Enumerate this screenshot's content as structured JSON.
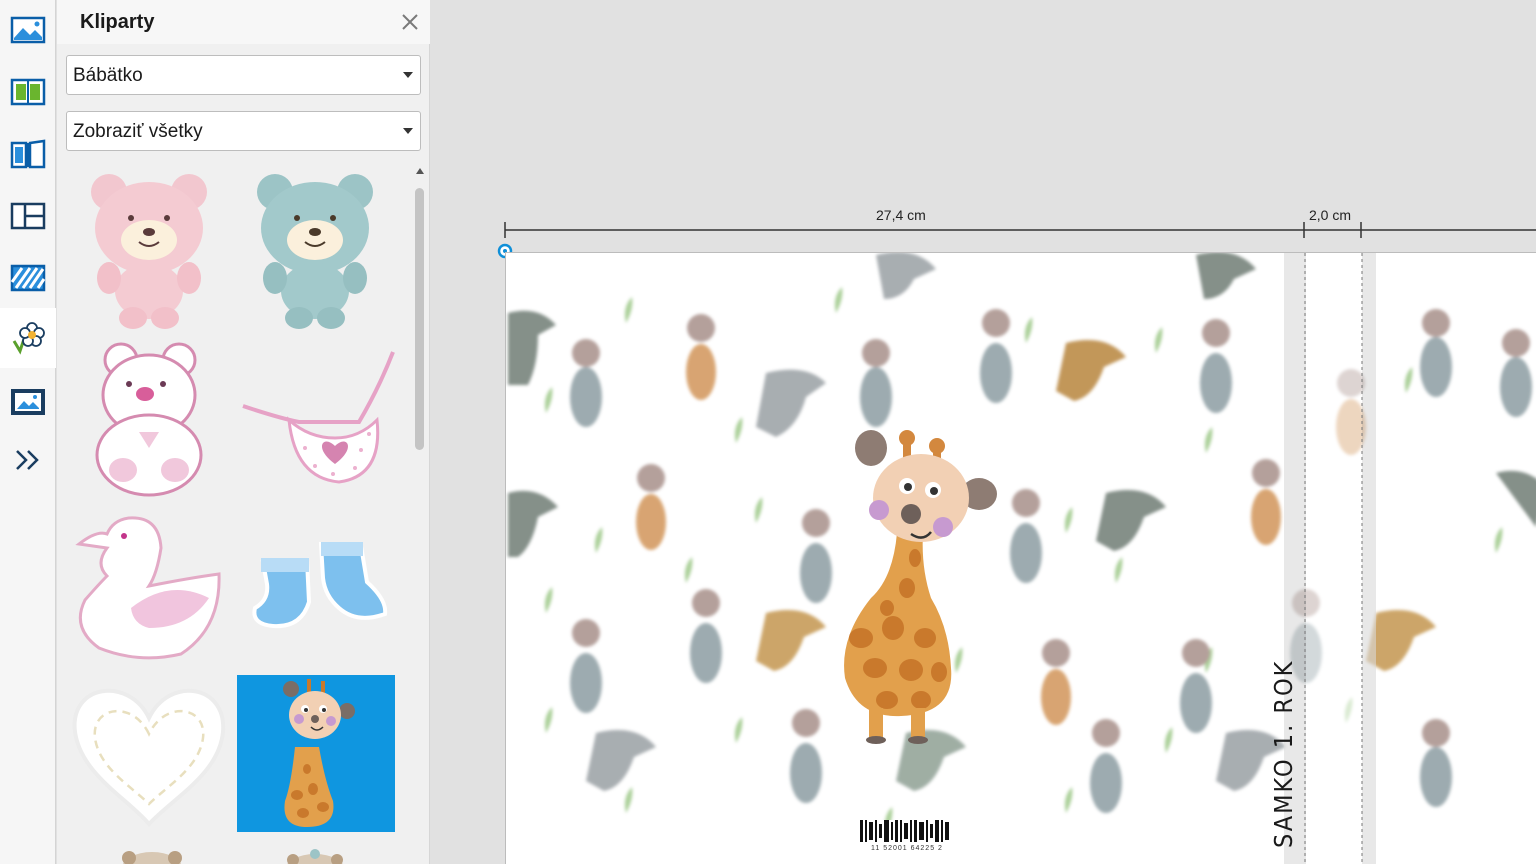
{
  "rail": {
    "items": [
      {
        "name": "backgrounds",
        "icon": "photo-landscape-icon"
      },
      {
        "name": "layouts",
        "icon": "book-pages-icon"
      },
      {
        "name": "cover",
        "icon": "book-cover-icon"
      },
      {
        "name": "page-layouts",
        "icon": "grid-layout-icon"
      },
      {
        "name": "patterns",
        "icon": "striped-pattern-icon"
      },
      {
        "name": "cliparts",
        "icon": "flower-icon",
        "active": true
      },
      {
        "name": "frames",
        "icon": "framed-picture-icon"
      },
      {
        "name": "more",
        "icon": "double-chevron-right-icon"
      }
    ]
  },
  "panel": {
    "title": "Kliparty",
    "category_value": "Bábätko",
    "filter_value": "Zobraziť všetky",
    "cliparts": [
      {
        "name": "pink-teddy-bear",
        "icon": "pink-bear-icon"
      },
      {
        "name": "blue-teddy-bear",
        "icon": "blue-bear-icon"
      },
      {
        "name": "plush-teddy-bear",
        "icon": "plush-bear-icon"
      },
      {
        "name": "baby-bib",
        "icon": "bib-icon"
      },
      {
        "name": "rubber-duck",
        "icon": "duck-icon"
      },
      {
        "name": "baby-socks",
        "icon": "socks-icon"
      },
      {
        "name": "stitched-heart",
        "icon": "heart-icon"
      },
      {
        "name": "giraffe",
        "icon": "giraffe-icon",
        "selected": true
      }
    ]
  },
  "canvas": {
    "front_width": "27,4 cm",
    "spine_width": "2,0 cm",
    "spine_text": "SAMKO 1. ROK",
    "barcode_text": "11  52001  64225  2"
  },
  "colors": {
    "accent": "#0f8fd8",
    "selected_clip_bg": "#0f96e0",
    "giraffe_orange": "#e2a04c",
    "panel_bg": "#f0f0f0",
    "canvas_bg": "#e1e1e1"
  }
}
